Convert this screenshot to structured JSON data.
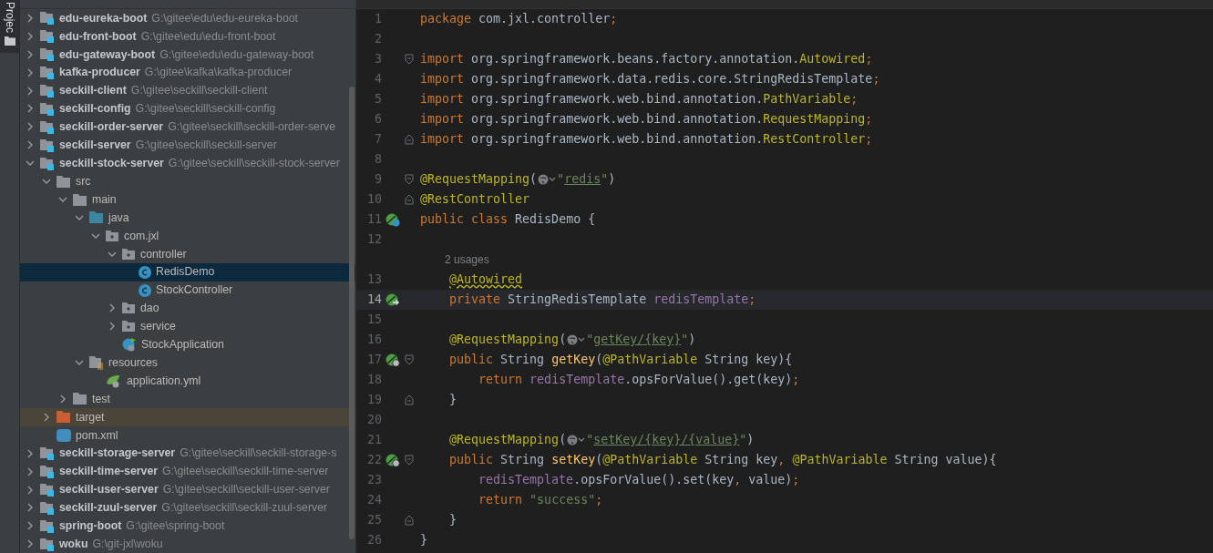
{
  "tool_strip": {
    "label": "Projec"
  },
  "project_tree": [
    {
      "name": "edu-eureka-boot",
      "path": "G:\\gitee\\edu\\edu-eureka-boot",
      "kind": "module",
      "expanded": false,
      "selected": false
    },
    {
      "name": "edu-front-boot",
      "path": "G:\\gitee\\edu\\edu-front-boot",
      "kind": "module",
      "expanded": false,
      "selected": false
    },
    {
      "name": "edu-gateway-boot",
      "path": "G:\\gitee\\edu\\edu-gateway-boot",
      "kind": "module",
      "expanded": false,
      "selected": false
    },
    {
      "name": "kafka-producer",
      "path": "G:\\gitee\\kafka\\kafka-producer",
      "kind": "module",
      "expanded": false,
      "selected": false
    },
    {
      "name": "seckill-client",
      "path": "G:\\gitee\\seckill\\seckill-client",
      "kind": "module",
      "expanded": false,
      "selected": false
    },
    {
      "name": "seckill-config",
      "path": "G:\\gitee\\seckill\\seckill-config",
      "kind": "module",
      "expanded": false,
      "selected": false
    },
    {
      "name": "seckill-order-server",
      "path": "G:\\gitee\\seckill\\seckill-order-serve",
      "kind": "module",
      "expanded": false,
      "selected": false
    },
    {
      "name": "seckill-server",
      "path": "G:\\gitee\\seckill\\seckill-server",
      "kind": "module",
      "expanded": false,
      "selected": false
    },
    {
      "name": "seckill-stock-server",
      "path": "G:\\gitee\\seckill\\seckill-stock-server",
      "kind": "module",
      "expanded": true,
      "selected": false,
      "children": [
        {
          "name": "src",
          "kind": "folder",
          "expanded": true,
          "selected": false,
          "children": [
            {
              "name": "main",
              "kind": "folder",
              "expanded": true,
              "selected": false,
              "children": [
                {
                  "name": "java",
                  "kind": "source",
                  "expanded": true,
                  "selected": false,
                  "children": [
                    {
                      "name": "com.jxl",
                      "kind": "package",
                      "expanded": true,
                      "selected": false,
                      "children": [
                        {
                          "name": "controller",
                          "kind": "package",
                          "expanded": true,
                          "selected": false,
                          "children": [
                            {
                              "name": "RedisDemo",
                              "kind": "class",
                              "selected": true
                            },
                            {
                              "name": "StockController",
                              "kind": "class",
                              "selected": false
                            }
                          ]
                        },
                        {
                          "name": "dao",
                          "kind": "package",
                          "expanded": false,
                          "selected": false
                        },
                        {
                          "name": "service",
                          "kind": "package",
                          "expanded": false,
                          "selected": false
                        },
                        {
                          "name": "StockApplication",
                          "kind": "app",
                          "selected": false
                        }
                      ]
                    }
                  ]
                },
                {
                  "name": "resources",
                  "kind": "resources",
                  "expanded": true,
                  "selected": false,
                  "children": [
                    {
                      "name": "application.yml",
                      "kind": "yml",
                      "selected": false
                    }
                  ]
                }
              ]
            },
            {
              "name": "test",
              "kind": "folder",
              "expanded": false,
              "selected": false
            }
          ]
        },
        {
          "name": "target",
          "kind": "excluded",
          "expanded": false,
          "selected": false
        },
        {
          "name": "pom.xml",
          "kind": "maven",
          "selected": false
        }
      ]
    },
    {
      "name": "seckill-storage-server",
      "path": "G:\\gitee\\seckill\\seckill-storage-s",
      "kind": "module",
      "expanded": false,
      "selected": false
    },
    {
      "name": "seckill-time-server",
      "path": "G:\\gitee\\seckill\\seckill-time-server",
      "kind": "module",
      "expanded": false,
      "selected": false
    },
    {
      "name": "seckill-user-server",
      "path": "G:\\gitee\\seckill\\seckill-user-server",
      "kind": "module",
      "expanded": false,
      "selected": false
    },
    {
      "name": "seckill-zuul-server",
      "path": "G:\\gitee\\seckill\\seckill-zuul-server",
      "kind": "module",
      "expanded": false,
      "selected": false
    },
    {
      "name": "spring-boot",
      "path": "G:\\gitee\\spring-boot",
      "kind": "module",
      "expanded": false,
      "selected": false
    },
    {
      "name": "woku",
      "path": "G:\\git-jxl\\woku",
      "kind": "module",
      "expanded": false,
      "selected": false
    }
  ],
  "editor": {
    "lines": [
      {
        "kind": "code",
        "number": "1",
        "tokens": [
          {
            "kind": "keyword",
            "text": "package"
          },
          {
            "kind": "plain",
            "text": " com.jxl.controller"
          },
          {
            "kind": "keyword",
            "text": ";"
          }
        ]
      },
      {
        "kind": "code",
        "number": "2"
      },
      {
        "kind": "code",
        "number": "3",
        "fold_marker": {
          "kind": "start"
        },
        "tokens": [
          {
            "kind": "keyword",
            "text": "import"
          },
          {
            "kind": "plain",
            "text": " org.springframework.beans.factory.annotation."
          },
          {
            "kind": "annotation",
            "text": "Autowired"
          },
          {
            "kind": "keyword",
            "text": ";"
          }
        ]
      },
      {
        "kind": "code",
        "number": "4",
        "tokens": [
          {
            "kind": "keyword",
            "text": "import"
          },
          {
            "kind": "plain",
            "text": " org.springframework.data.redis.core.StringRedisTemplate"
          },
          {
            "kind": "keyword",
            "text": ";"
          }
        ]
      },
      {
        "kind": "code",
        "number": "5",
        "tokens": [
          {
            "kind": "keyword",
            "text": "import"
          },
          {
            "kind": "plain",
            "text": " org.springframework.web.bind.annotation."
          },
          {
            "kind": "annotation",
            "text": "PathVariable"
          },
          {
            "kind": "keyword",
            "text": ";"
          }
        ]
      },
      {
        "kind": "code",
        "number": "6",
        "tokens": [
          {
            "kind": "keyword",
            "text": "import"
          },
          {
            "kind": "plain",
            "text": " org.springframework.web.bind.annotation."
          },
          {
            "kind": "annotation",
            "text": "RequestMapping"
          },
          {
            "kind": "keyword",
            "text": ";"
          }
        ]
      },
      {
        "kind": "code",
        "number": "7",
        "fold_marker": {
          "kind": "end"
        },
        "tokens": [
          {
            "kind": "keyword",
            "text": "import"
          },
          {
            "kind": "plain",
            "text": " org.springframework.web.bind.annotation."
          },
          {
            "kind": "annotation",
            "text": "RestController"
          },
          {
            "kind": "keyword",
            "text": ";"
          }
        ]
      },
      {
        "kind": "code",
        "number": "8"
      },
      {
        "kind": "code",
        "number": "9",
        "fold_marker": {
          "kind": "start"
        },
        "tokens": [
          {
            "kind": "annotation",
            "text": "@RequestMapping"
          },
          {
            "kind": "plain",
            "text": "("
          },
          {
            "kind": "globe"
          },
          {
            "kind": "string",
            "text": "\""
          },
          {
            "kind": "link",
            "text": "redis"
          },
          {
            "kind": "string",
            "text": "\""
          },
          {
            "kind": "plain",
            "text": ")"
          }
        ]
      },
      {
        "kind": "code",
        "number": "10",
        "fold_marker": {
          "kind": "end"
        },
        "tokens": [
          {
            "kind": "annotation",
            "text": "@RestController"
          }
        ]
      },
      {
        "kind": "code",
        "number": "11",
        "gutter_marker": {
          "kind": "bean-class"
        },
        "tokens": [
          {
            "kind": "keyword",
            "text": "public class"
          },
          {
            "kind": "plain",
            "text": " RedisDemo {"
          }
        ]
      },
      {
        "kind": "code",
        "number": "12"
      },
      {
        "kind": "inlay",
        "text": "2 usages"
      },
      {
        "kind": "code",
        "number": "13",
        "tokens": [
          {
            "kind": "annotation-warning",
            "text": "    @Autowired"
          }
        ]
      },
      {
        "kind": "code",
        "number": "14",
        "current": true,
        "gutter_marker": {
          "kind": "bean-field"
        },
        "tokens": [
          {
            "kind": "keyword",
            "text": "    private"
          },
          {
            "kind": "plain",
            "text": " StringRedisTemplate "
          },
          {
            "kind": "field",
            "text": "redisTemplate"
          },
          {
            "kind": "keyword",
            "text": ";"
          }
        ]
      },
      {
        "kind": "code",
        "number": "15"
      },
      {
        "kind": "code",
        "number": "16",
        "tokens": [
          {
            "kind": "annotation",
            "text": "    @RequestMapping"
          },
          {
            "kind": "plain",
            "text": "("
          },
          {
            "kind": "globe"
          },
          {
            "kind": "string",
            "text": "\""
          },
          {
            "kind": "link",
            "text": "getKey/{key}"
          },
          {
            "kind": "string",
            "text": "\""
          },
          {
            "kind": "plain",
            "text": ")"
          }
        ]
      },
      {
        "kind": "code",
        "number": "17",
        "gutter_marker": {
          "kind": "bean-web"
        },
        "fold_marker": {
          "kind": "start"
        },
        "tokens": [
          {
            "kind": "keyword",
            "text": "    public"
          },
          {
            "kind": "plain",
            "text": " String "
          },
          {
            "kind": "method",
            "text": "getKey"
          },
          {
            "kind": "plain",
            "text": "("
          },
          {
            "kind": "annotation",
            "text": "@PathVariable"
          },
          {
            "kind": "plain",
            "text": " String key){"
          }
        ]
      },
      {
        "kind": "code",
        "number": "18",
        "tokens": [
          {
            "kind": "keyword",
            "text": "        return"
          },
          {
            "kind": "field",
            "text": " redisTemplate"
          },
          {
            "kind": "plain",
            "text": ".opsForValue().get(key)"
          },
          {
            "kind": "keyword",
            "text": ";"
          }
        ]
      },
      {
        "kind": "code",
        "number": "19",
        "fold_marker": {
          "kind": "end"
        },
        "tokens": [
          {
            "kind": "plain",
            "text": "    }"
          }
        ]
      },
      {
        "kind": "code",
        "number": "20"
      },
      {
        "kind": "code",
        "number": "21",
        "tokens": [
          {
            "kind": "annotation",
            "text": "    @RequestMapping"
          },
          {
            "kind": "plain",
            "text": "("
          },
          {
            "kind": "globe"
          },
          {
            "kind": "string",
            "text": "\""
          },
          {
            "kind": "link",
            "text": "setKey/{key}/{value}"
          },
          {
            "kind": "string",
            "text": "\""
          },
          {
            "kind": "plain",
            "text": ")"
          }
        ]
      },
      {
        "kind": "code",
        "number": "22",
        "gutter_marker": {
          "kind": "bean-web"
        },
        "fold_marker": {
          "kind": "start"
        },
        "tokens": [
          {
            "kind": "keyword",
            "text": "    public"
          },
          {
            "kind": "plain",
            "text": " String "
          },
          {
            "kind": "method",
            "text": "setKey"
          },
          {
            "kind": "plain",
            "text": "("
          },
          {
            "kind": "annotation",
            "text": "@PathVariable"
          },
          {
            "kind": "plain",
            "text": " String key"
          },
          {
            "kind": "keyword",
            "text": ","
          },
          {
            "kind": "annotation",
            "text": " @PathVariable"
          },
          {
            "kind": "plain",
            "text": " String value){"
          }
        ]
      },
      {
        "kind": "code",
        "number": "23",
        "tokens": [
          {
            "kind": "field",
            "text": "        redisTemplate"
          },
          {
            "kind": "plain",
            "text": ".opsForValue().set(key"
          },
          {
            "kind": "keyword",
            "text": ","
          },
          {
            "kind": "plain",
            "text": " value)"
          },
          {
            "kind": "keyword",
            "text": ";"
          }
        ]
      },
      {
        "kind": "code",
        "number": "24",
        "tokens": [
          {
            "kind": "keyword",
            "text": "        return"
          },
          {
            "kind": "string",
            "text": " \"success\""
          },
          {
            "kind": "keyword",
            "text": ";"
          }
        ]
      },
      {
        "kind": "code",
        "number": "25",
        "fold_marker": {
          "kind": "end"
        },
        "tokens": [
          {
            "kind": "plain",
            "text": "    }"
          }
        ]
      },
      {
        "kind": "code",
        "number": "26",
        "tokens": [
          {
            "kind": "plain",
            "text": "}"
          }
        ]
      }
    ]
  }
}
